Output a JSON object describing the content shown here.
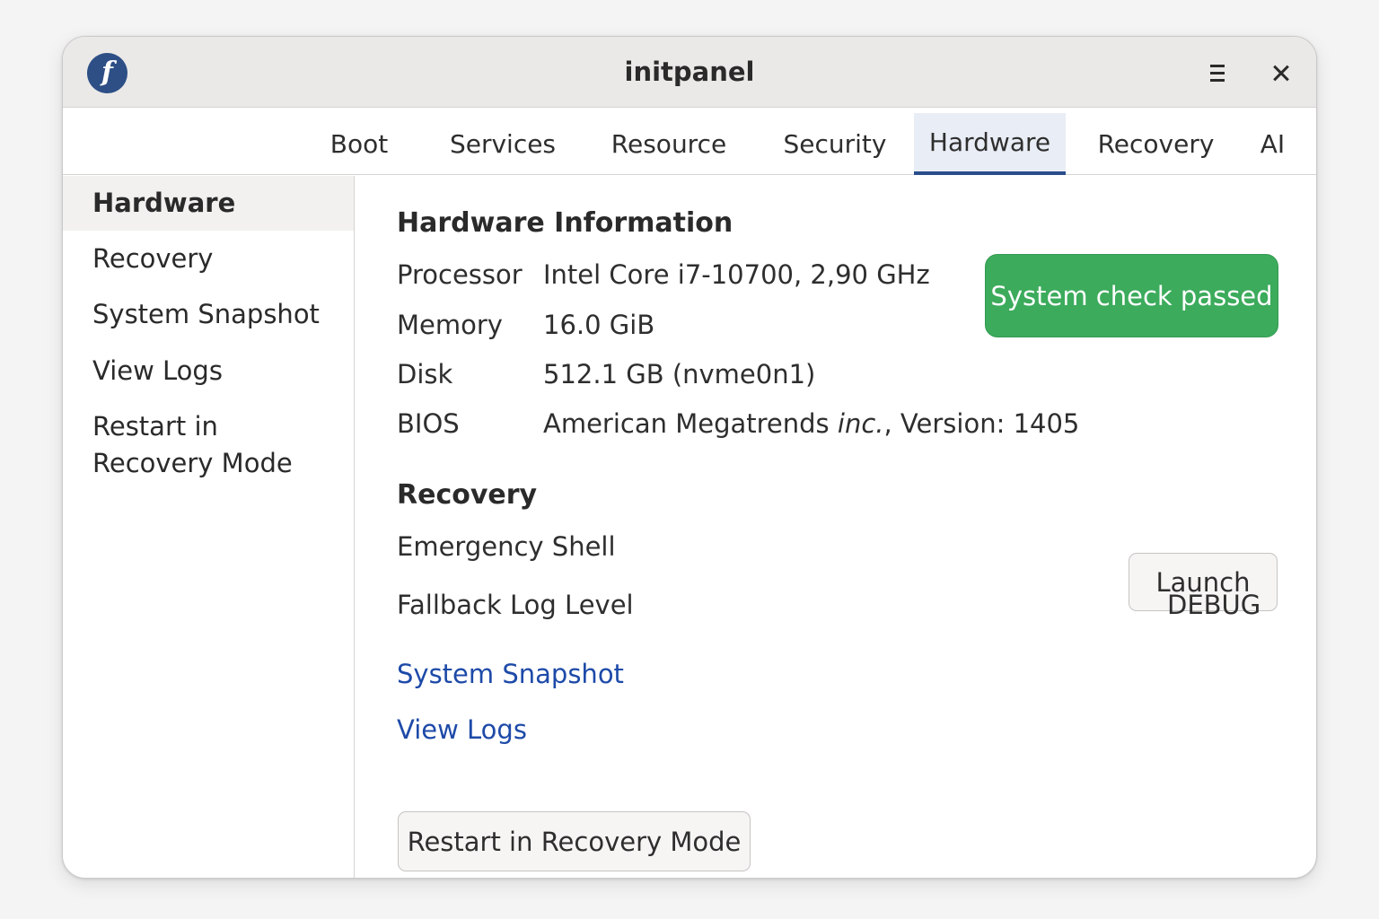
{
  "window": {
    "title": "initpanel"
  },
  "titlebar": {
    "logo_glyph": "f"
  },
  "tabs": [
    {
      "label": "Boot"
    },
    {
      "label": "Services"
    },
    {
      "label": "Resource"
    },
    {
      "label": "Security"
    },
    {
      "label": "Hardware",
      "active": true
    },
    {
      "label": "Recovery"
    },
    {
      "label": "AI"
    }
  ],
  "sidebar": {
    "items": [
      {
        "label": "Hardware",
        "active": true
      },
      {
        "label": "Recovery"
      },
      {
        "label": "System Snapshot"
      },
      {
        "label": "View Logs"
      },
      {
        "label": "Restart in Recovery Mode"
      }
    ]
  },
  "hardware": {
    "heading": "Hardware Information",
    "rows": [
      {
        "label": "Processor",
        "value": "Intel Core i7-10700, 2,90 GHz"
      },
      {
        "label": "Memory",
        "value": "16.0 GiB"
      },
      {
        "label": "Disk",
        "value": "512.1 GB (nvme0n1)"
      },
      {
        "label": "BIOS",
        "value_prefix": "American Megatrends ",
        "value_italic": "inc.",
        "value_suffix": ", Version: 1405"
      }
    ],
    "status_badge": "System check passed",
    "status_color": "#3cab5c"
  },
  "recovery": {
    "heading": "Recovery",
    "emergency_shell_label": "Emergency Shell",
    "launch_button": "Launch",
    "fallback_log_level_label": "Fallback Log Level",
    "fallback_log_level_value": "DEBUG"
  },
  "links": {
    "system_snapshot": "System Snapshot",
    "view_logs": "View Logs"
  },
  "restart_button": "Restart in Recovery Mode",
  "colors": {
    "accent": "#2a4d8c",
    "link": "#1d4aa8",
    "success": "#3cab5c"
  }
}
